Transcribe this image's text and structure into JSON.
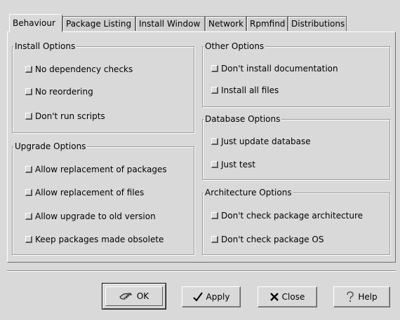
{
  "tabs": [
    {
      "label": "Behaviour"
    },
    {
      "label": "Package Listing"
    },
    {
      "label": "Install Window"
    },
    {
      "label": "Network"
    },
    {
      "label": "Rpmfind"
    },
    {
      "label": "Distributions"
    }
  ],
  "groups": {
    "install": {
      "title": "Install Options",
      "options": [
        "No dependency checks",
        "No reordering",
        "Don't run scripts"
      ]
    },
    "upgrade": {
      "title": "Upgrade Options",
      "options": [
        "Allow replacement of packages",
        "Allow replacement of files",
        "Allow upgrade to old version",
        "Keep packages made obsolete"
      ]
    },
    "other": {
      "title": "Other Options",
      "options": [
        "Don't install documentation",
        "Install all files"
      ]
    },
    "database": {
      "title": "Database Options",
      "options": [
        "Just update database",
        "Just test"
      ]
    },
    "architecture": {
      "title": "Architecture Options",
      "options": [
        "Don't check package architecture",
        "Don't check package OS"
      ]
    }
  },
  "buttons": {
    "ok": "OK",
    "apply": "Apply",
    "close": "Close",
    "help": "Help"
  },
  "icons": {
    "ok": "hand-pointer-icon",
    "apply": "checkmark-icon",
    "close": "x-icon",
    "help": "question-mark-icon"
  }
}
